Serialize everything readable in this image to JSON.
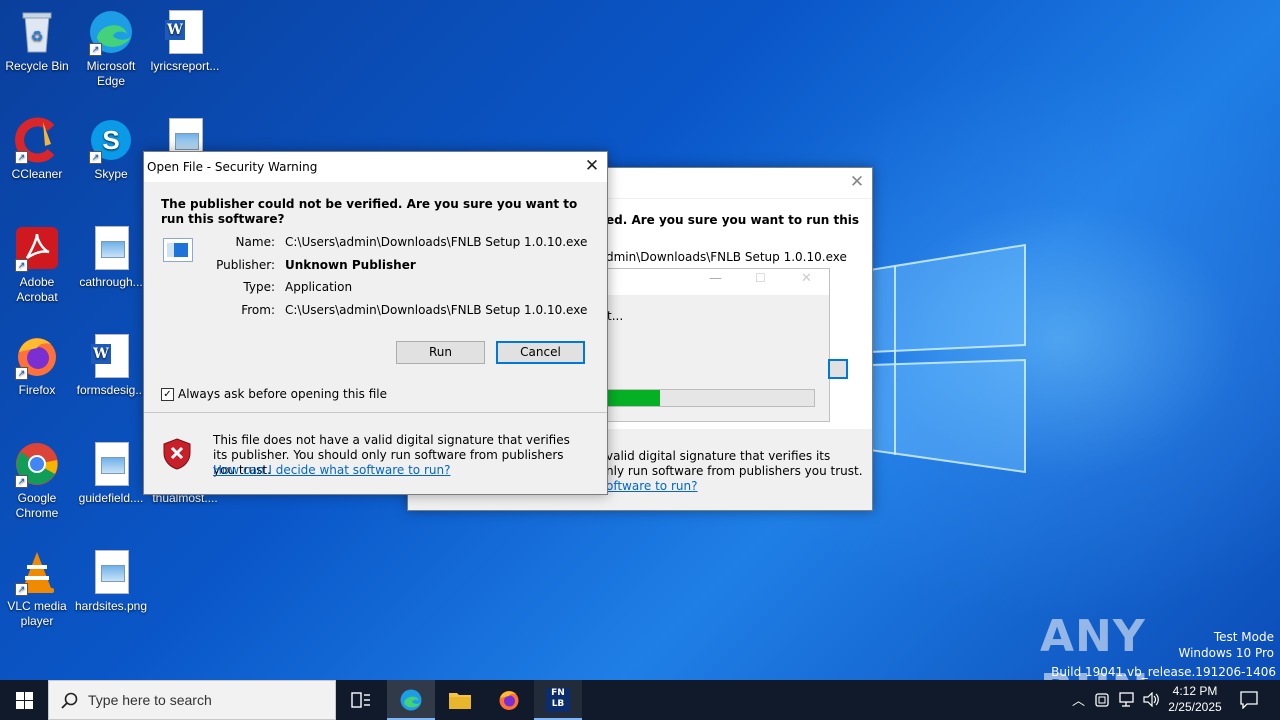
{
  "desktop_icons": [
    {
      "label": "Recycle Bin"
    },
    {
      "label": "Microsoft Edge"
    },
    {
      "label": "lyricsreport..."
    },
    {
      "label": "CCleaner"
    },
    {
      "label": "Skype"
    },
    {
      "label": "Adobe Acrobat"
    },
    {
      "label": "cathrough..."
    },
    {
      "label": "Firefox"
    },
    {
      "label": "formsdesig..."
    },
    {
      "label": "Google Chrome"
    },
    {
      "label": "guidefield...."
    },
    {
      "label": "thualmost...."
    },
    {
      "label": "VLC media player"
    },
    {
      "label": "hardsites.png"
    }
  ],
  "back_dialog": {
    "heading_fragment": "ed.  Are you sure you want to run this",
    "name_fragment": "dmin\\Downloads\\FNLB Setup 1.0.10.exe",
    "progress_fragment": "t...",
    "progress_percent": 25,
    "sig_line1": "valid digital signature that verifies its",
    "sig_line2": "nly run software from publishers you trust.",
    "sig_link": "oftware to run?"
  },
  "dialog": {
    "title": "Open File - Security Warning",
    "heading": "The publisher could not be verified.  Are you sure you want to run this software?",
    "fields": [
      {
        "label": "Name:",
        "value": "C:\\Users\\admin\\Downloads\\FNLB Setup 1.0.10.exe"
      },
      {
        "label": "Publisher:",
        "value": "Unknown Publisher"
      },
      {
        "label": "Type:",
        "value": "Application"
      },
      {
        "label": "From:",
        "value": "C:\\Users\\admin\\Downloads\\FNLB Setup 1.0.10.exe"
      }
    ],
    "run_label": "Run",
    "cancel_label": "Cancel",
    "checkbox_label": "Always ask before opening this file",
    "checkbox_checked": true,
    "warning_text": "This file does not have a valid digital signature that verifies its publisher.  You should only run software from publishers you trust.",
    "warning_link": "How can I decide what software to run?"
  },
  "taskbar": {
    "search_placeholder": "Type here to search",
    "time": "4:12 PM",
    "date": "2/25/2025"
  },
  "watermark": {
    "line1": "Test Mode",
    "line2": "Windows 10 Pro",
    "line3": "Build 19041.vb_release.191206-1406",
    "brand": "ANY RUN"
  },
  "colors": {
    "accent": "#0078d7",
    "progress": "#06b025",
    "taskbar": "#101a2a"
  }
}
